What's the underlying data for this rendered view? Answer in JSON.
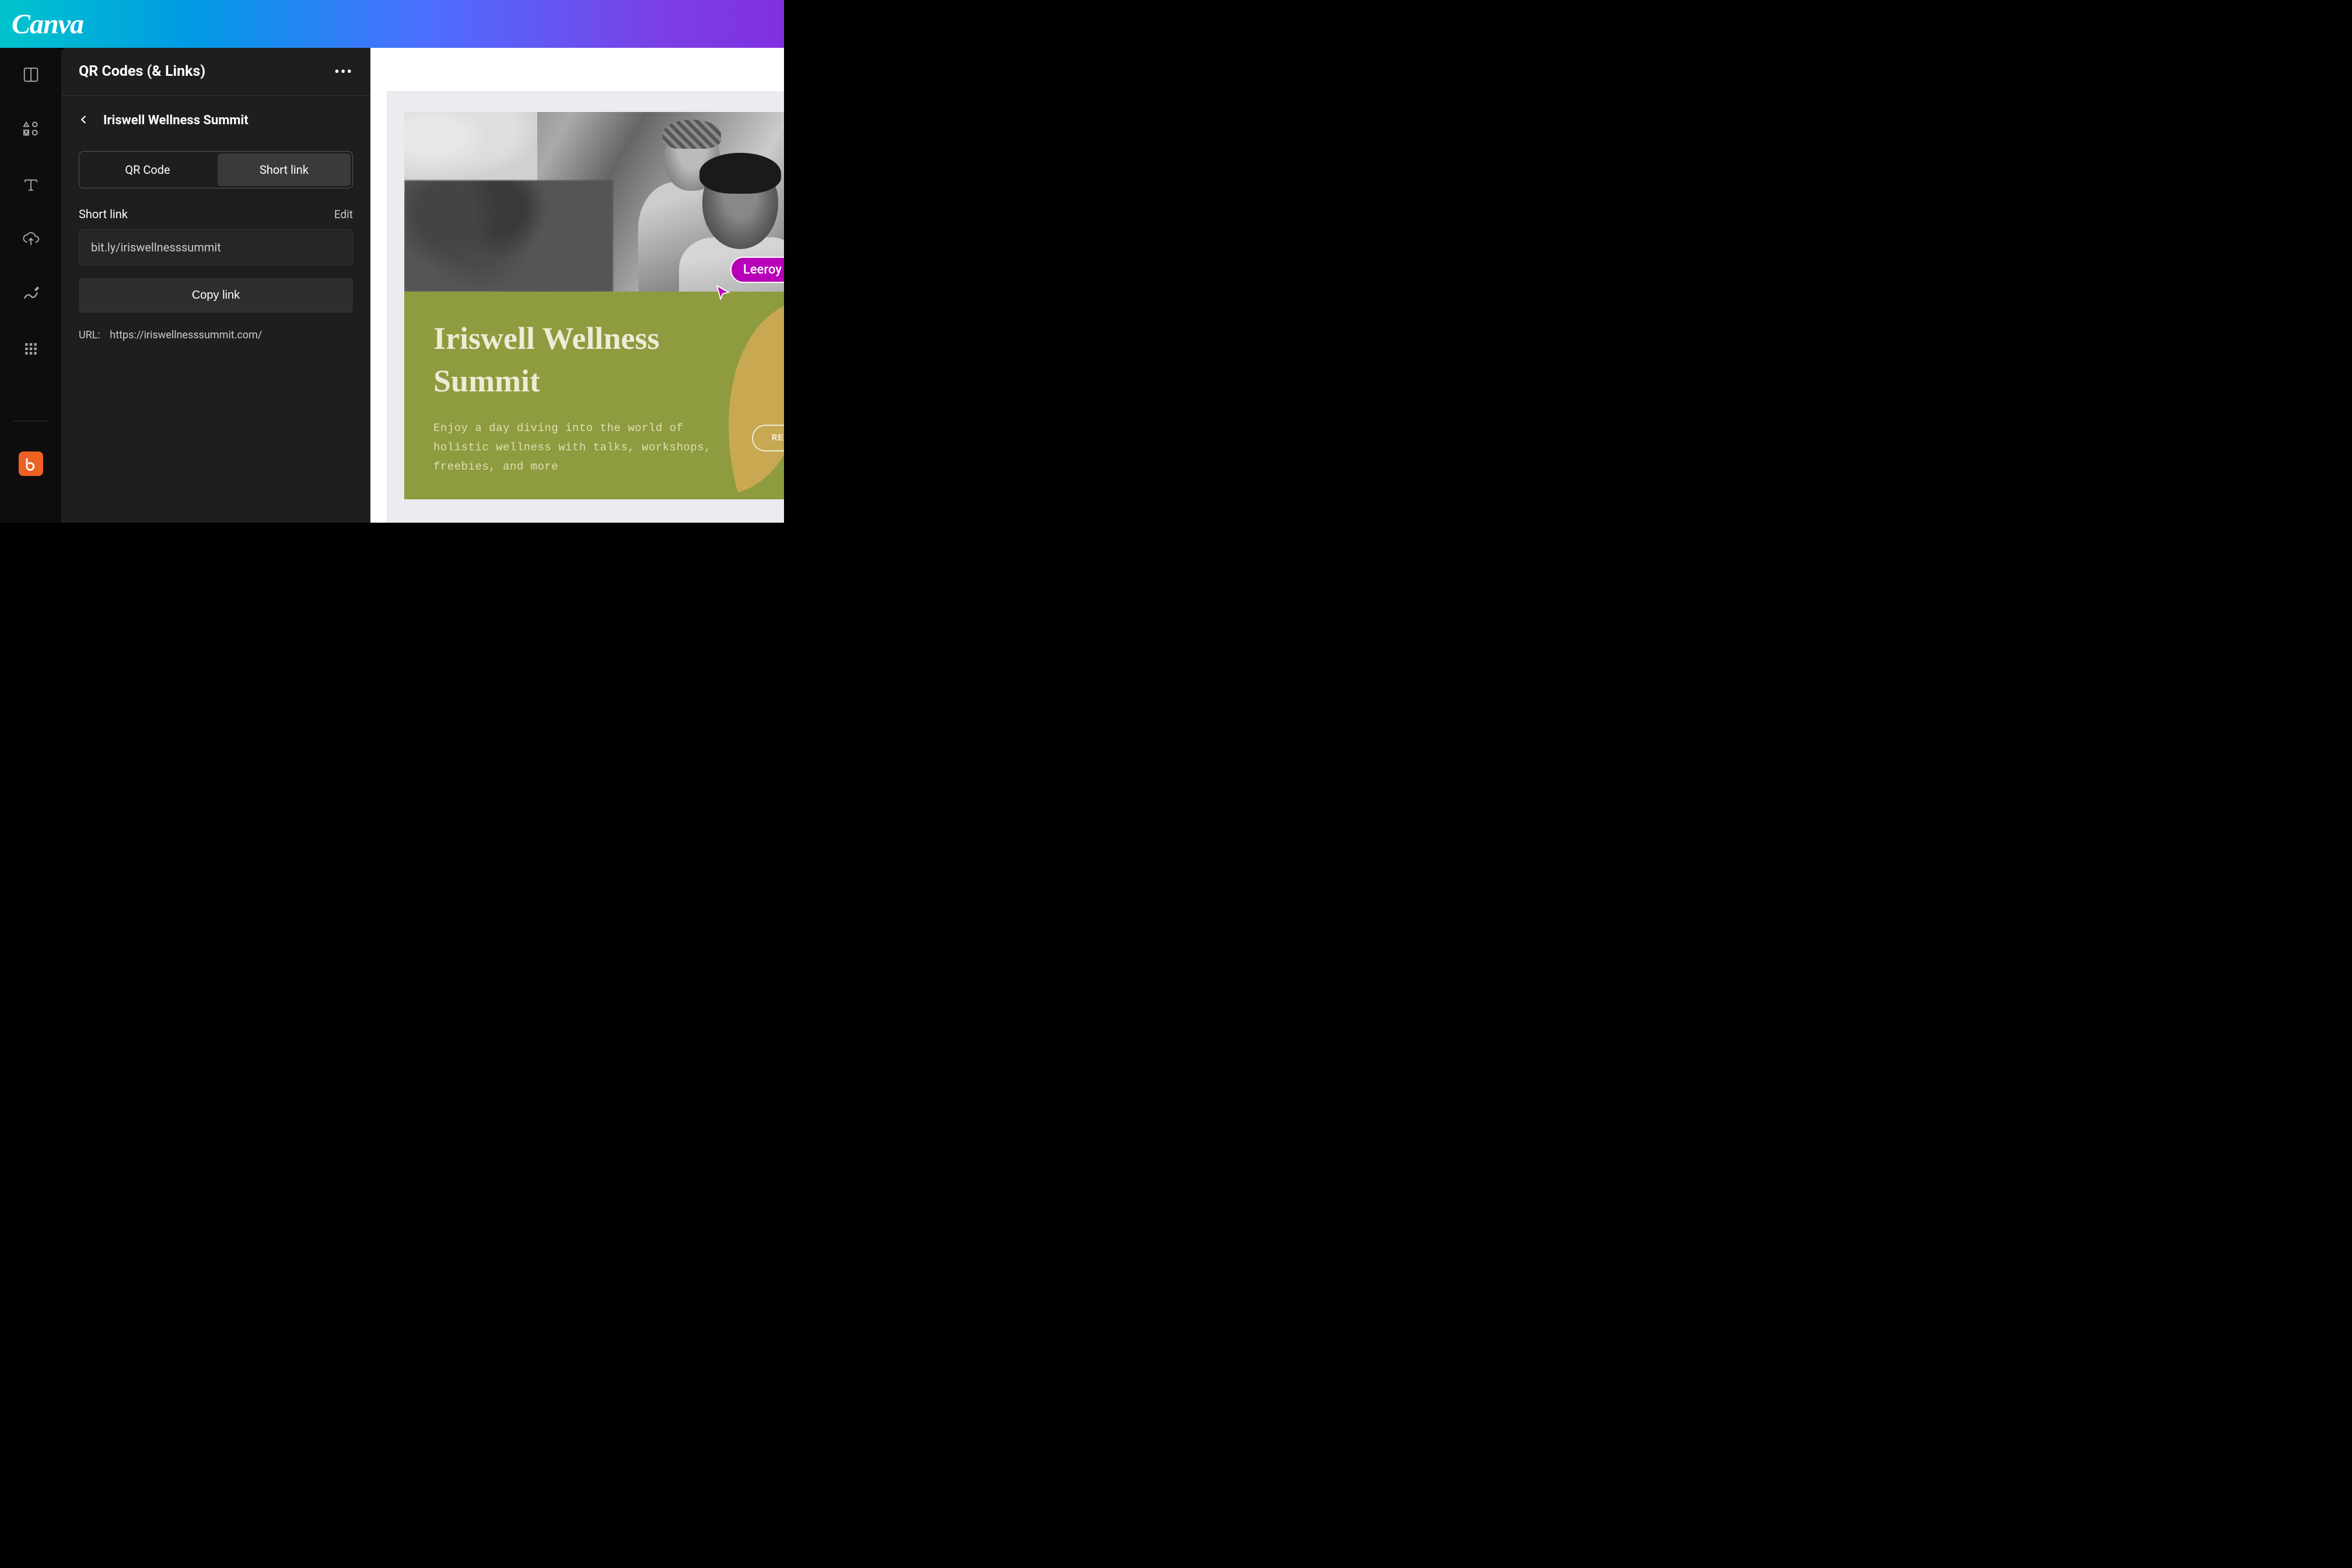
{
  "header": {
    "logo": "Canva"
  },
  "panel": {
    "title": "QR Codes (& Links)",
    "backTitle": "Iriswell Wellness Summit",
    "tabs": {
      "qrcode": "QR Code",
      "shortlink": "Short link"
    },
    "shortLinkLabel": "Short link",
    "editLabel": "Edit",
    "linkValue": "bit.ly/iriswellnesssummit",
    "copyButton": "Copy link",
    "urlLabel": "URL:",
    "urlValue": "https://iriswellnesssummit.com/"
  },
  "design": {
    "title": "Iriswell Wellness Summit",
    "description": "Enjoy a day diving into the world of holistic wellness with talks, workshops, freebies, and more",
    "buttonPartial": "RE"
  },
  "cursor": {
    "userName": "Leeroy"
  }
}
